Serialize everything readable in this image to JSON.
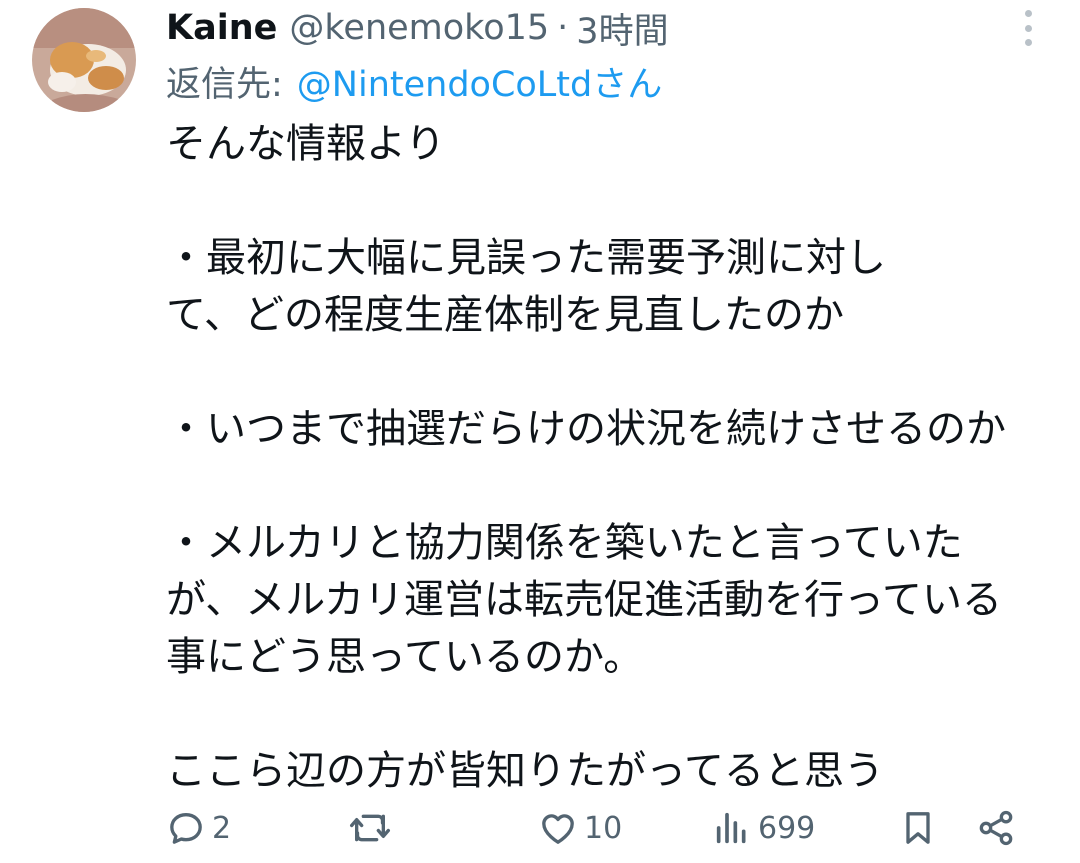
{
  "tweet": {
    "author_name": "Kaine",
    "handle": "@kenemoko15",
    "separator": "·",
    "time": "3時間",
    "reply_label": "返信先:",
    "reply_user": "@NintendoCoLtdさん",
    "text": "そんな情報より\n\n・最初に大幅に見誤った需要予測に対し\nて、どの程度生産体制を見直したのか\n\n・いつまで抽選だらけの状況を続けさせるのか\n\n・メルカリと協力関係を築いたと言っていた\nが、メルカリ運営は転売促進活動を行っている\n事にどう思っているのか。\n\nここら辺の方が皆知りたがってると思う"
  },
  "actions": {
    "reply_count": "2",
    "like_count": "10",
    "views_count": "699"
  },
  "icons": {
    "avatar": "cat-avatar",
    "more": "more-vertical-icon",
    "reply": "reply-icon",
    "retweet": "retweet-icon",
    "like": "heart-icon",
    "views": "views-icon",
    "bookmark": "bookmark-icon",
    "share": "share-icon"
  },
  "colors": {
    "text": "#0f1419",
    "secondary": "#536471",
    "link": "#1d9bf0"
  }
}
